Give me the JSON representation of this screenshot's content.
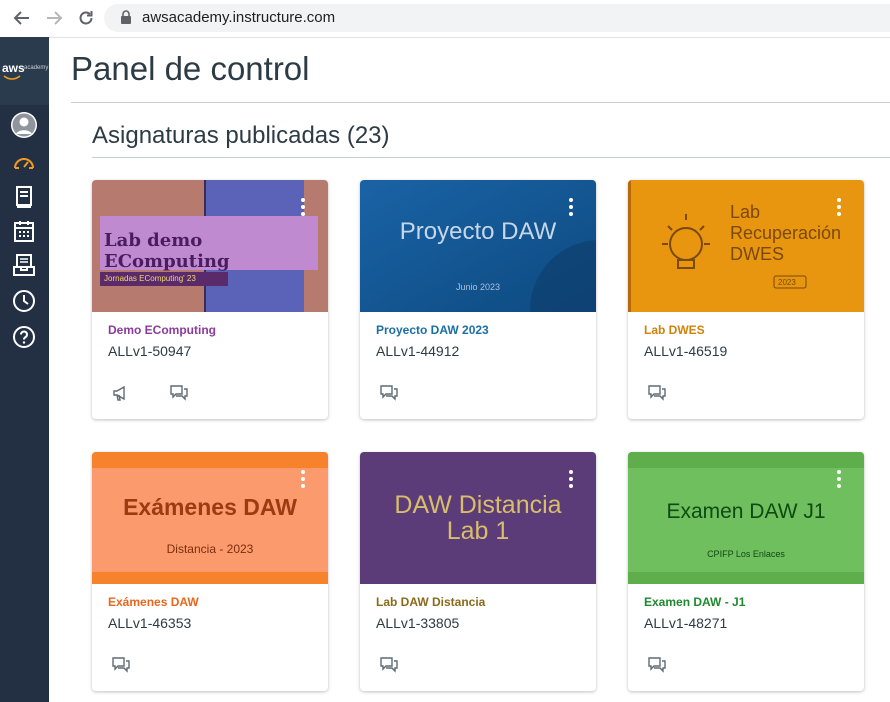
{
  "browser": {
    "url": "awsacademy.instructure.com"
  },
  "sidebar": {
    "logo_text": "aws",
    "logo_sub": "academy",
    "items": [
      {
        "name": "account"
      },
      {
        "name": "dashboard"
      },
      {
        "name": "courses"
      },
      {
        "name": "calendar"
      },
      {
        "name": "inbox"
      },
      {
        "name": "history"
      },
      {
        "name": "help"
      }
    ]
  },
  "page": {
    "title": "Panel de control",
    "section_title": "Asignaturas publicadas (23)"
  },
  "cards": [
    {
      "name": "Demo EComputing",
      "code": "ALLv1-50947",
      "color": "#8b3a9e",
      "hero_title": "Lab demo EComputing",
      "hero_sub": "Jornadas EComputing' 23",
      "icons": [
        "announcement-icon",
        "discussion-icon"
      ]
    },
    {
      "name": "Proyecto DAW 2023",
      "code": "ALLv1-44912",
      "color": "#1a6ea6",
      "hero_title": "Proyecto DAW",
      "hero_sub": "Junio 2023",
      "icons": [
        "discussion-icon"
      ]
    },
    {
      "name": "Lab DWES",
      "code": "ALLv1-46519",
      "color": "#d0820a",
      "hero_title": "Lab\nRecuperación\nDWES",
      "hero_sub": "2023",
      "icons": [
        "discussion-icon"
      ]
    },
    {
      "name": "Exámenes DAW",
      "code": "ALLv1-46353",
      "color": "#e8661d",
      "hero_title": "Exámenes DAW",
      "hero_sub": "Distancia - 2023",
      "icons": [
        "discussion-icon"
      ]
    },
    {
      "name": "Lab DAW Distancia",
      "code": "ALLv1-33805",
      "color": "#8a6a1a",
      "hero_title": "DAW Distancia\nLab 1",
      "hero_sub": "",
      "icons": [
        "discussion-icon"
      ]
    },
    {
      "name": "Examen DAW - J1",
      "code": "ALLv1-48271",
      "color": "#1e8a2e",
      "hero_title": "Examen DAW J1",
      "hero_sub": "CPIFP Los Enlaces",
      "icons": [
        "discussion-icon"
      ]
    }
  ]
}
